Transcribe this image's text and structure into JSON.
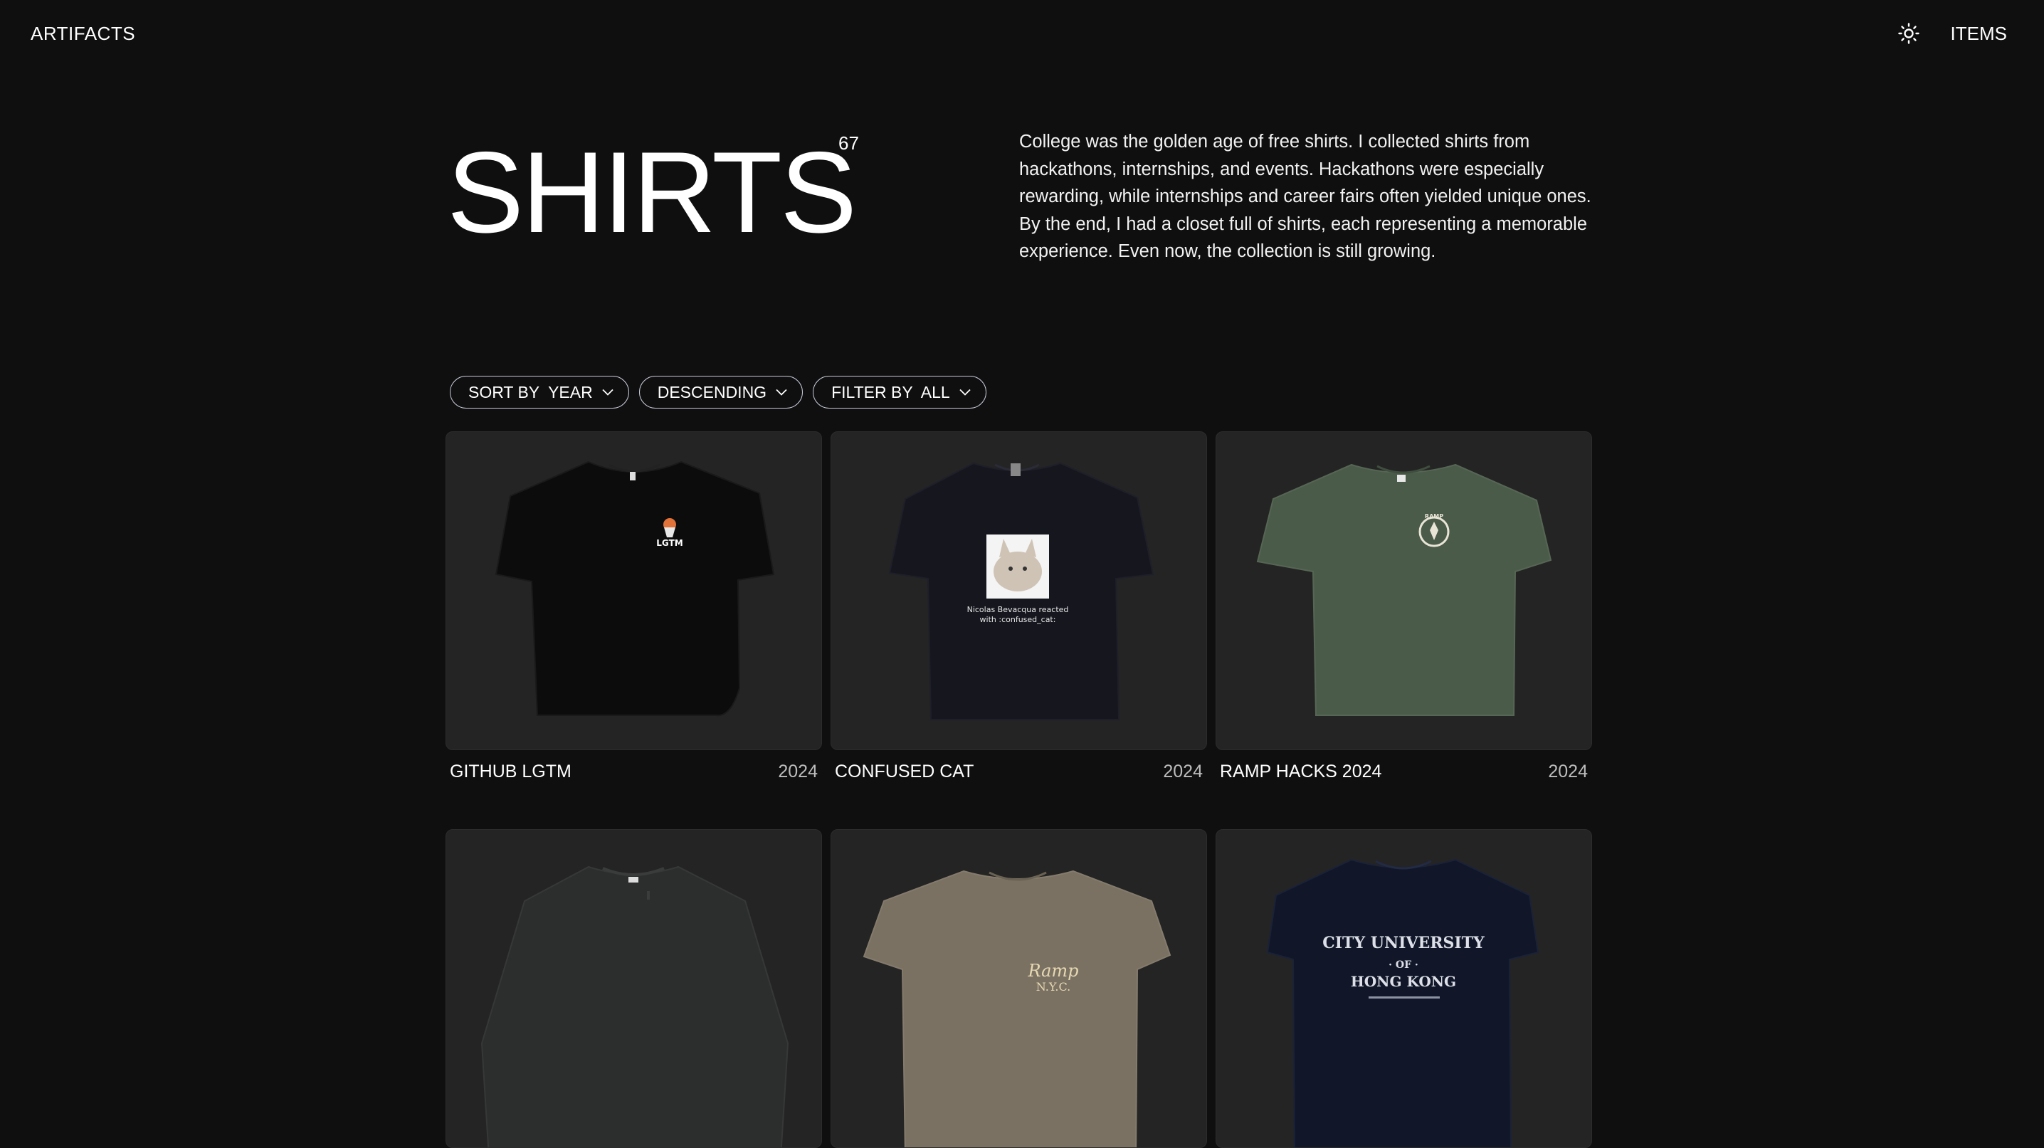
{
  "header": {
    "brand": "ARTIFACTS",
    "items_link": "ITEMS",
    "theme_icon": "sun-icon"
  },
  "hero": {
    "title": "SHIRTS",
    "count": "67",
    "description": "College was the golden age of free shirts. I collected shirts from hackathons, internships, and events. Hackathons were especially rewarding, while internships and career fairs often yielded unique ones. By the end, I had a closet full of shirts, each representing a memorable experience. Even now, the collection is still growing."
  },
  "filters": [
    {
      "label": "SORT BY  YEAR",
      "icon": "chevron-down-icon"
    },
    {
      "label": "DESCENDING",
      "icon": "chevron-down-icon"
    },
    {
      "label": "FILTER BY  ALL",
      "icon": "chevron-down-icon"
    }
  ],
  "shirts": [
    {
      "name": "GITHUB LGTM",
      "year": "2024",
      "color": "#0d0d0d",
      "graphic_text": "LGTM"
    },
    {
      "name": "CONFUSED CAT",
      "year": "2024",
      "color": "#14151c",
      "graphic_text": "Nicolas Bevacqua reacted with :confused_cat:"
    },
    {
      "name": "RAMP HACKS 2024",
      "year": "2024",
      "color": "#4a5a48",
      "graphic_text": "RAMP"
    },
    {
      "name": "",
      "year": "",
      "color": "#2b2d2c",
      "graphic_text": ""
    },
    {
      "name": "",
      "year": "",
      "color": "#7a7163",
      "graphic_text": "Ramp N.Y.C."
    },
    {
      "name": "",
      "year": "",
      "color": "#10162a",
      "graphic_text": "CITY UNIVERSITY · OF · HONG KONG"
    }
  ],
  "colors": {
    "background": "#0f0f0f",
    "card": "#242424",
    "pill_border": "#c7cad8"
  }
}
